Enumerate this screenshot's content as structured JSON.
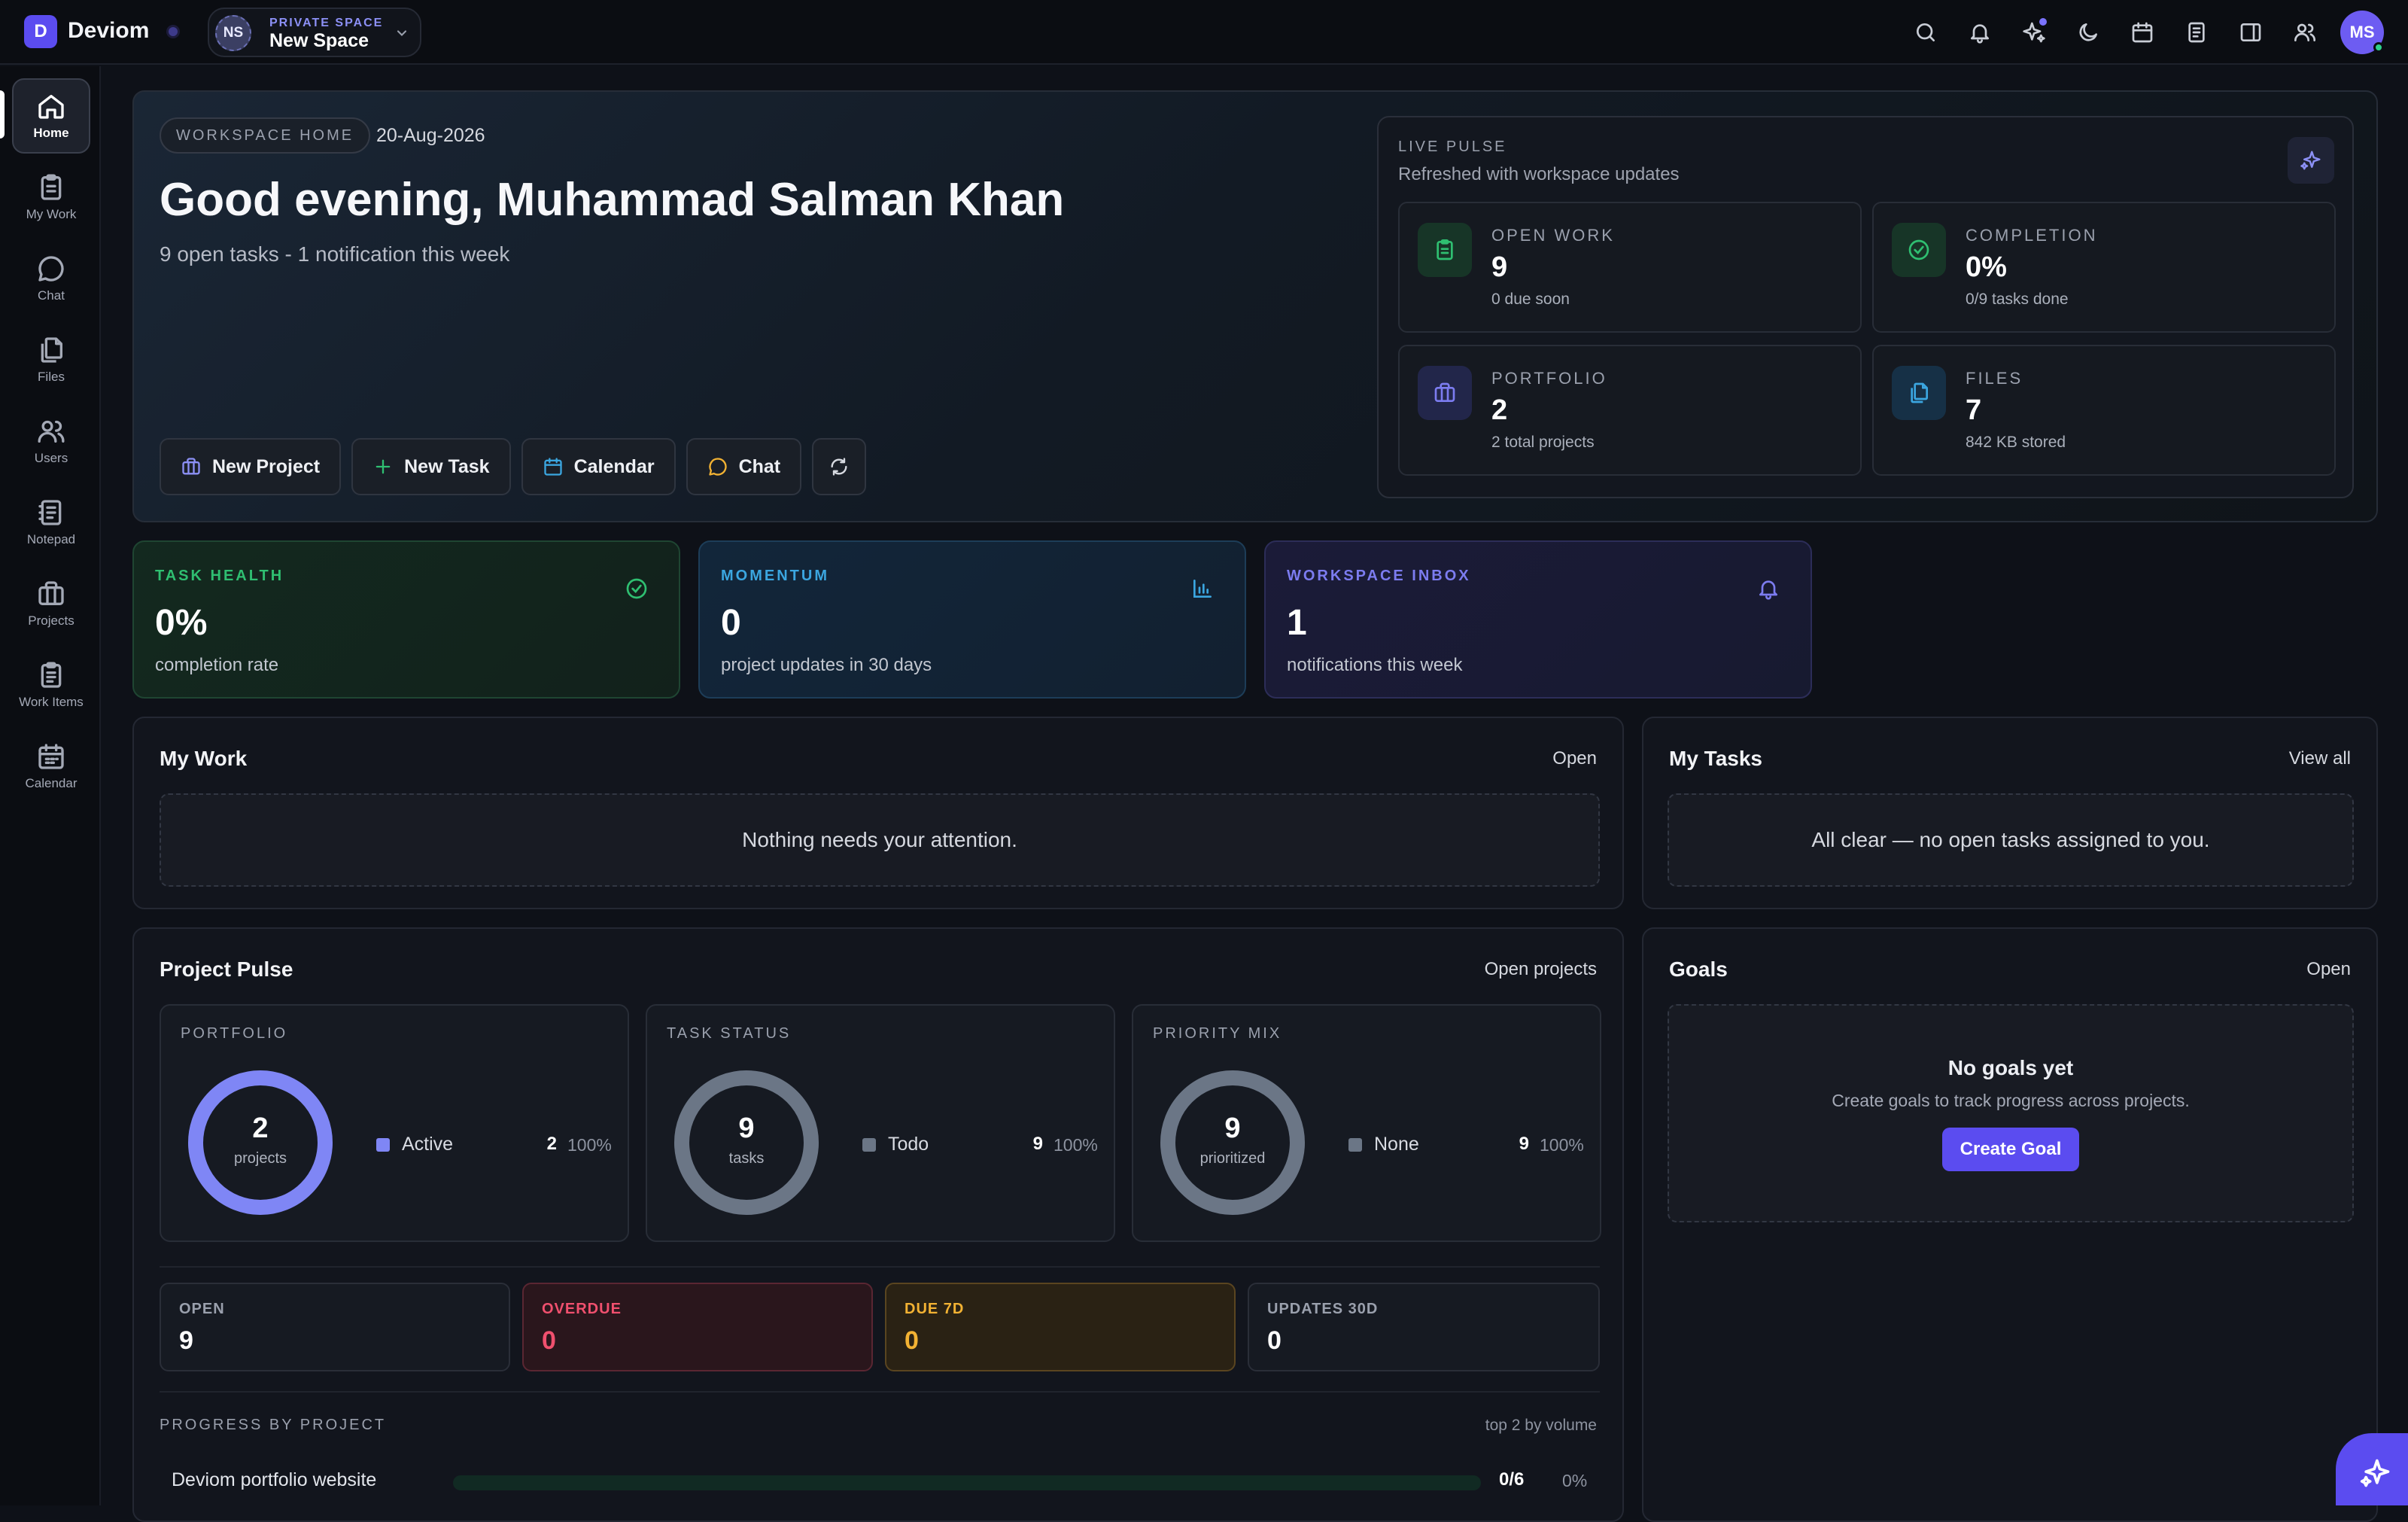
{
  "app": {
    "logo_letter": "D",
    "name": "Deviom"
  },
  "space": {
    "initials": "NS",
    "kicker": "PRIVATE SPACE",
    "name": "New Space"
  },
  "user": {
    "initials": "MS"
  },
  "topbar_icons": [
    "search-icon",
    "bell-icon",
    "sparkles-icon",
    "moon-icon",
    "calendar-icon",
    "notepad-icon",
    "sidebar-icon",
    "users-icon"
  ],
  "nav": [
    {
      "label": "Home",
      "icon": "home-icon"
    },
    {
      "label": "My Work",
      "icon": "clipboard-icon"
    },
    {
      "label": "Chat",
      "icon": "chat-icon"
    },
    {
      "label": "Files",
      "icon": "files-icon"
    },
    {
      "label": "Users",
      "icon": "users-icon"
    },
    {
      "label": "Notepad",
      "icon": "notepad-icon"
    },
    {
      "label": "Projects",
      "icon": "briefcase-icon"
    },
    {
      "label": "Work Items",
      "icon": "clipboard-list-icon"
    },
    {
      "label": "Calendar",
      "icon": "calendar-icon"
    }
  ],
  "hero": {
    "pill": "WORKSPACE HOME",
    "date": "20-Aug-2026",
    "greeting": "Good evening, Muhammad Salman Khan",
    "subtitle": "9 open tasks - 1 notification this week",
    "actions": [
      {
        "label": "New Project",
        "icon": "briefcase-icon"
      },
      {
        "label": "New Task",
        "icon": "plus-icon"
      },
      {
        "label": "Calendar",
        "icon": "calendar-icon"
      },
      {
        "label": "Chat",
        "icon": "chat-icon"
      }
    ]
  },
  "pulse": {
    "kicker": "LIVE PULSE",
    "subtitle": "Refreshed with workspace updates",
    "stats": [
      {
        "label": "OPEN WORK",
        "value": "9",
        "sub": "0 due soon",
        "icon": "clipboard-icon",
        "color": "#2fbf71"
      },
      {
        "label": "COMPLETION",
        "value": "0%",
        "sub": "0/9 tasks done",
        "icon": "check-circle-icon",
        "color": "#2fbf71"
      },
      {
        "label": "PORTFOLIO",
        "value": "2",
        "sub": "2 total projects",
        "icon": "briefcase-icon",
        "color": "#7c7cf0"
      },
      {
        "label": "FILES",
        "value": "7",
        "sub": "842 KB stored",
        "icon": "files-icon",
        "color": "#3ba6e0"
      }
    ]
  },
  "kpis": [
    {
      "label": "TASK HEALTH",
      "value": "0%",
      "sub": "completion rate",
      "icon": "check-circle-icon",
      "color": "#2fbf71"
    },
    {
      "label": "MOMENTUM",
      "value": "0",
      "sub": "project updates in 30 days",
      "icon": "bar-chart-icon",
      "color": "#3ba6e0"
    },
    {
      "label": "WORKSPACE INBOX",
      "value": "1",
      "sub": "notifications this week",
      "icon": "bell-icon",
      "color": "#7c7cf0"
    }
  ],
  "my_work": {
    "title": "My Work",
    "link": "Open",
    "empty": "Nothing needs your attention."
  },
  "my_tasks": {
    "title": "My Tasks",
    "link": "View all",
    "empty": "All clear — no open tasks assigned to you."
  },
  "project_pulse": {
    "title": "Project Pulse",
    "link": "Open projects",
    "donuts": [
      {
        "label": "PORTFOLIO",
        "value": "2",
        "caption": "projects",
        "legend": "Active",
        "count": "2",
        "pct": "100%",
        "color": "#7f86f5",
        "fraction": 1.0
      },
      {
        "label": "TASK STATUS",
        "value": "9",
        "caption": "tasks",
        "legend": "Todo",
        "count": "9",
        "pct": "100%",
        "color": "#6b7686",
        "fraction": 1.0
      },
      {
        "label": "PRIORITY MIX",
        "value": "9",
        "caption": "prioritized",
        "legend": "None",
        "count": "9",
        "pct": "100%",
        "color": "#6b7686",
        "fraction": 1.0
      }
    ],
    "tiles": [
      {
        "label": "OPEN",
        "value": "9",
        "color": "#9aa0ad"
      },
      {
        "label": "OVERDUE",
        "value": "0",
        "color": "#f0506e"
      },
      {
        "label": "DUE 7D",
        "value": "0",
        "color": "#f2b233"
      },
      {
        "label": "UPDATES 30D",
        "value": "0",
        "color": "#9aa0ad"
      }
    ],
    "progress_kicker": "PROGRESS BY PROJECT",
    "progress_right": "top 2 by volume",
    "projects": [
      {
        "name": "Deviom portfolio website",
        "count": "0/6",
        "pct": "0%",
        "fraction": 0
      }
    ]
  },
  "goals": {
    "title": "Goals",
    "link": "Open",
    "empty_title": "No goals yet",
    "empty_sub": "Create goals to track progress across projects.",
    "button": "Create Goal"
  }
}
